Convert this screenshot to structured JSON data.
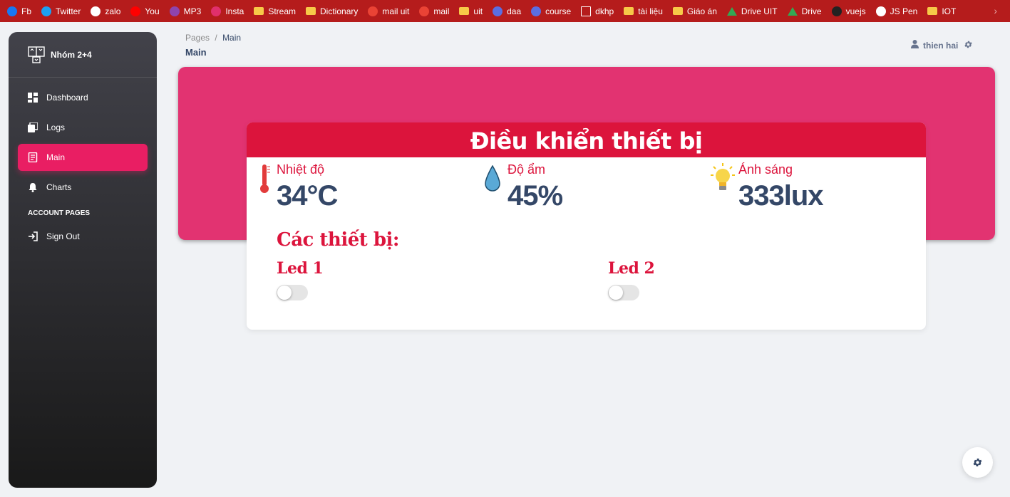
{
  "bookmarks": [
    {
      "label": "Fb",
      "icon": "facebook-icon",
      "color": "#1877f2"
    },
    {
      "label": "Twitter",
      "icon": "twitter-icon",
      "color": "#1da1f2"
    },
    {
      "label": "zalo",
      "icon": "zalo-icon",
      "color": "#ffffff"
    },
    {
      "label": "You",
      "icon": "youtube-icon",
      "color": "#ff0000"
    },
    {
      "label": "MP3",
      "icon": "mp3-icon",
      "color": "#8e44ad"
    },
    {
      "label": "Insta",
      "icon": "instagram-icon",
      "color": "#e1306c"
    },
    {
      "label": "Stream",
      "icon": "folder-icon",
      "color": "#f7c948"
    },
    {
      "label": "Dictionary",
      "icon": "folder-icon",
      "color": "#f7c948"
    },
    {
      "label": "mail uit",
      "icon": "gmail-icon",
      "color": "#ea4335"
    },
    {
      "label": "mail",
      "icon": "gmail-icon",
      "color": "#ea4335"
    },
    {
      "label": "uit",
      "icon": "folder-icon",
      "color": "#f7c948"
    },
    {
      "label": "daa",
      "icon": "course-icon",
      "color": "#5b6ee1"
    },
    {
      "label": "course",
      "icon": "course-icon",
      "color": "#5b6ee1"
    },
    {
      "label": "dkhp",
      "icon": "document-icon",
      "color": "#ffffff"
    },
    {
      "label": "tài liệu",
      "icon": "folder-icon",
      "color": "#f7c948"
    },
    {
      "label": "Giáo án",
      "icon": "folder-icon",
      "color": "#f7c948"
    },
    {
      "label": "Drive UIT",
      "icon": "drive-icon",
      "color": "#34a853"
    },
    {
      "label": "Drive",
      "icon": "drive-icon",
      "color": "#34a853"
    },
    {
      "label": "vuejs",
      "icon": "github-icon",
      "color": "#222222"
    },
    {
      "label": "JS Pen",
      "icon": "codepen-icon",
      "color": "#ffffff"
    },
    {
      "label": "IOT",
      "icon": "folder-icon",
      "color": "#f7c948"
    }
  ],
  "sidebar": {
    "brand": "Nhóm 2+4",
    "items": [
      {
        "label": "Dashboard",
        "icon": "dashboard-icon"
      },
      {
        "label": "Logs",
        "icon": "logs-icon"
      },
      {
        "label": "Main",
        "icon": "receipt-icon",
        "active": true
      },
      {
        "label": "Charts",
        "icon": "bell-icon"
      }
    ],
    "section_title": "ACCOUNT PAGES",
    "account_items": [
      {
        "label": "Sign Out",
        "icon": "sign-out-icon"
      }
    ]
  },
  "header": {
    "breadcrumb_root": "Pages",
    "breadcrumb_sep": "/",
    "breadcrumb_current": "Main",
    "title": "Main",
    "user_name": "thien hai"
  },
  "card": {
    "title": "Điều khiển thiết bị",
    "metrics": [
      {
        "label": "Nhiệt độ",
        "value": "34°C",
        "icon": "thermometer-icon"
      },
      {
        "label": "Độ ẩm",
        "value": "45%",
        "icon": "water-drop-icon"
      },
      {
        "label": "Ánh sáng",
        "value": "333lux",
        "icon": "light-bulb-icon"
      }
    ],
    "devices_title": "Các thiết bị:",
    "devices": [
      {
        "label": "Led 1",
        "on": false
      },
      {
        "label": "Led 2",
        "on": false
      }
    ]
  },
  "colors": {
    "accent": "#e91e63",
    "banner": "#e23371",
    "card_header": "#dc143c",
    "bookmark_bar": "#b51c1c"
  }
}
